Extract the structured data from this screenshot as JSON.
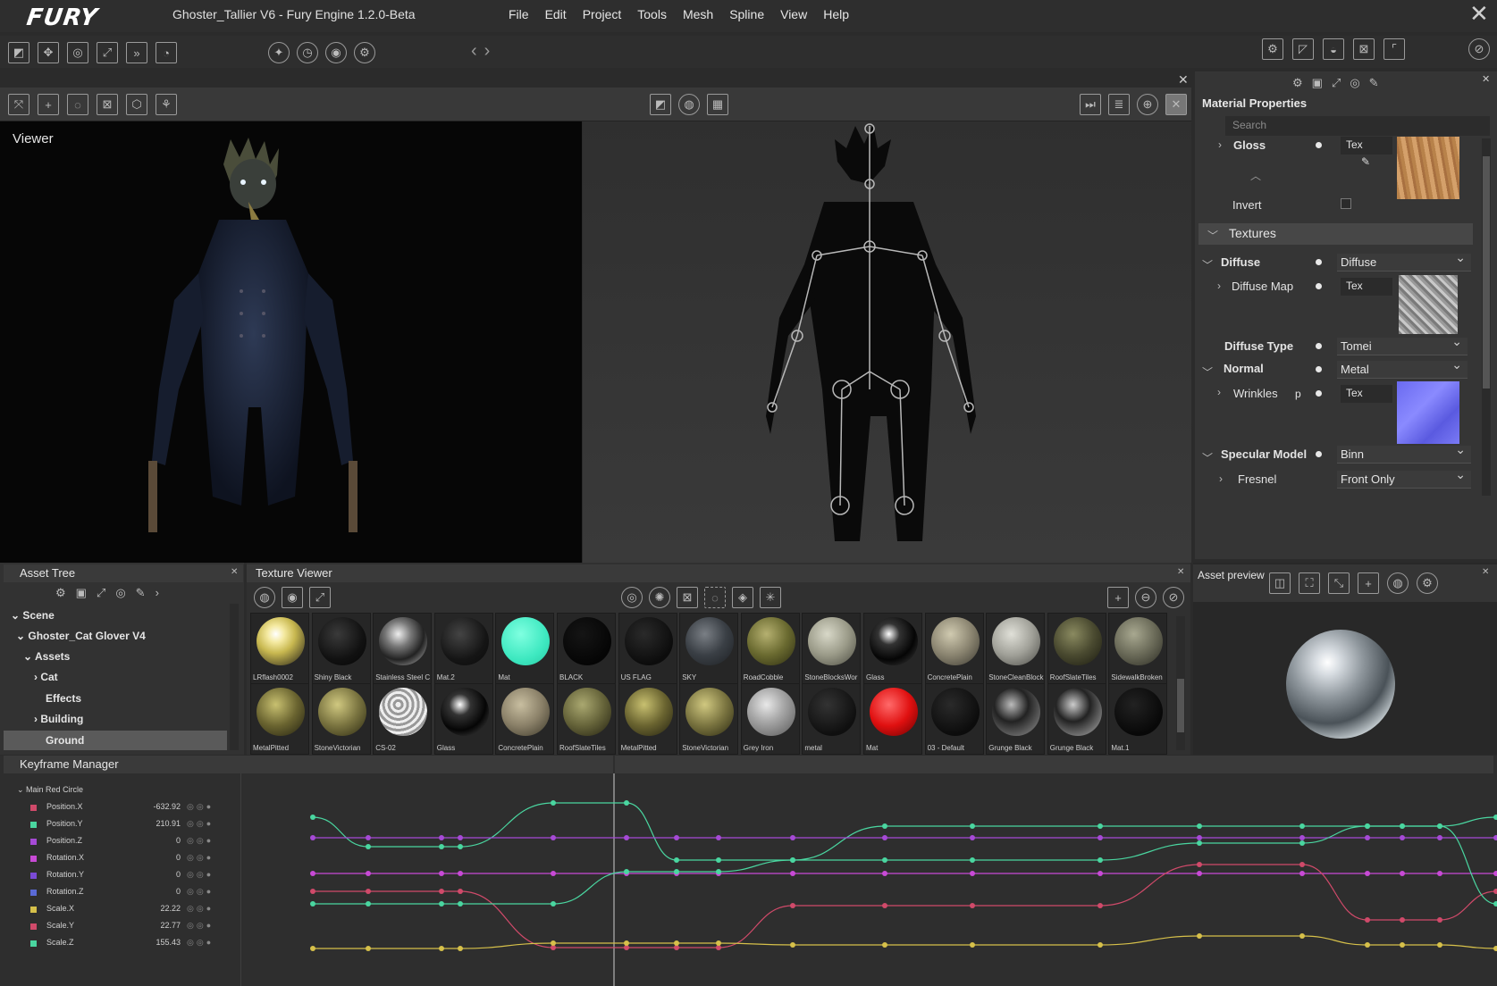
{
  "app": {
    "logo": "FURY",
    "window_title": "Ghoster_Tallier V6 - Fury Engine 1.2.0-Beta",
    "menu": [
      "File",
      "Edit",
      "Project",
      "Tools",
      "Mesh",
      "Spline",
      "View",
      "Help"
    ]
  },
  "viewer": {
    "label": "Viewer"
  },
  "material": {
    "title": "Material Properties",
    "search_placeholder": "Search",
    "gloss": {
      "label": "Gloss",
      "value": "Tex"
    },
    "invert": {
      "label": "Invert"
    },
    "textures_section": "Textures",
    "diffuse": {
      "label": "Diffuse",
      "value": "Diffuse"
    },
    "diffuse_map": {
      "label": "Diffuse Map",
      "value": "Tex"
    },
    "diffuse_type": {
      "label": "Diffuse Type",
      "value": "Tomei"
    },
    "normal": {
      "label": "Normal",
      "value": "Metal"
    },
    "wrinkles": {
      "label": "Wrinkles",
      "extra": "p",
      "value": "Tex"
    },
    "specular_model": {
      "label": "Specular Model",
      "value": "Binn"
    },
    "fresnel": {
      "label": "Fresnel",
      "value": "Front Only"
    }
  },
  "asset_tree": {
    "title": "Asset Tree",
    "items": [
      "Scene",
      "Ghoster_Cat Glover V4",
      "Assets",
      "Cat",
      "Effects",
      "Building",
      "Ground"
    ]
  },
  "texture_viewer": {
    "title": "Texture Viewer",
    "row1": [
      "LRflash0002",
      "Shiny Black",
      "Stainless Steel C",
      "Mat.2",
      "Mat",
      "BLACK",
      "US FLAG",
      "SKY",
      "RoadCobble",
      "StoneBlocksWor",
      "Glass",
      "ConcretePlain",
      "StoneCleanBlock",
      "RoofSlateTiles",
      "SidewalkBroken"
    ],
    "row2": [
      "MetalPitted",
      "StoneVictorian",
      "CS-02",
      "Glass",
      "ConcretePlain",
      "RoofSlateTiles",
      "MetalPitted",
      "StoneVictorian",
      "Grey Iron",
      "metal",
      "Mat",
      "03 - Default",
      "Grunge Black",
      "Grunge Black",
      "Mat.1"
    ]
  },
  "asset_preview": {
    "title": "Asset preview"
  },
  "keyframe": {
    "title": "Keyframe Manager",
    "group": "Main Red Circle",
    "channels": [
      {
        "name": "Position.X",
        "value": "-632.92",
        "color": "#d04a6a"
      },
      {
        "name": "Position.Y",
        "value": "210.91",
        "color": "#4ad6a0"
      },
      {
        "name": "Position.Z",
        "value": "0",
        "color": "#a64ad6"
      },
      {
        "name": "Rotation.X",
        "value": "0",
        "color": "#c84ad6"
      },
      {
        "name": "Rotation.Y",
        "value": "0",
        "color": "#7a4ad6"
      },
      {
        "name": "Rotation.Z",
        "value": "0",
        "color": "#5a6ad6"
      },
      {
        "name": "Scale.X",
        "value": "22.22",
        "color": "#d6c04a"
      },
      {
        "name": "Scale.Y",
        "value": "22.77",
        "color": "#d04a6a"
      },
      {
        "name": "Scale.Z",
        "value": "155.43",
        "color": "#4ad6a0"
      }
    ]
  }
}
